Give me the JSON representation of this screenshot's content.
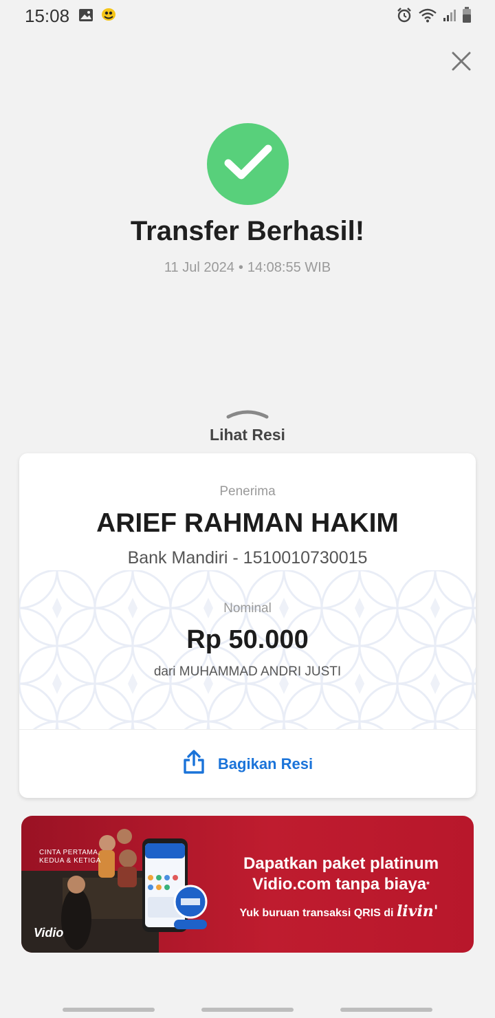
{
  "status_bar": {
    "time": "15:08",
    "left_icons": [
      "image-icon",
      "app-notification-icon"
    ],
    "right_icons": [
      "alarm-icon",
      "wifi-icon",
      "signal-icon",
      "battery-icon"
    ]
  },
  "header": {
    "close_icon": "close-icon"
  },
  "success": {
    "icon": "check-icon",
    "color": "#58d07b",
    "title": "Transfer Berhasil!",
    "date": "11 Jul 2024",
    "separator": "•",
    "time": "14:08:55 WIB"
  },
  "receipt_toggle": {
    "icon": "chevron-up-icon",
    "label": "Lihat Resi"
  },
  "receipt": {
    "recipient_label": "Penerima",
    "recipient_name": "ARIEF RAHMAN HAKIM",
    "recipient_bank": "Bank Mandiri - 1510010730015",
    "amount_label": "Nominal",
    "amount": "Rp 50.000",
    "sender": "dari MUHAMMAD ANDRI JUSTI",
    "share_icon": "share-icon",
    "share_label": "Bagikan Resi",
    "accent_color": "#1a73d9"
  },
  "promo": {
    "tagline_1": "CINTA PERTAMA,",
    "tagline_2": "KEDUA & KETIGA",
    "title_1": "Dapatkan paket platinum",
    "title_2": "Vidio.com tanpa biaya",
    "title_mark": "*",
    "subtitle": "Yuk buruan transaksi QRIS di",
    "brand": "livin'",
    "vidio_logo": "Vidio",
    "background_color": "#bf1c2f"
  }
}
